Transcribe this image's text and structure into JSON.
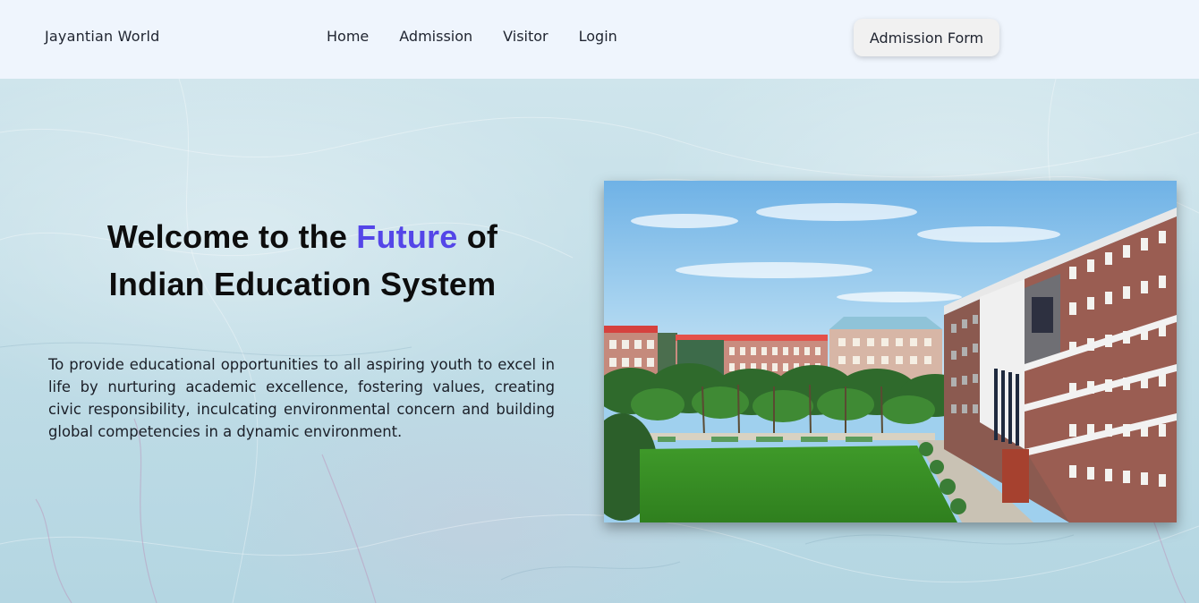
{
  "navbar": {
    "brand": "Jayantian World",
    "links": [
      {
        "label": "Home"
      },
      {
        "label": "Admission"
      },
      {
        "label": "Visitor"
      },
      {
        "label": "Login"
      }
    ],
    "cta_label": "Admission Form"
  },
  "hero": {
    "title_part1": "Welcome to the ",
    "title_accent": "Future",
    "title_part2": " of",
    "title_line2": "Indian Education System",
    "description": "To provide educational opportunities to all aspiring youth to excel in life by nurturing academic excellence, fostering values, creating civic responsibility, inculcating environmental concern and building global competencies in a dynamic environment.",
    "accent_color": "#5446e8"
  },
  "image": {
    "subject": "campus-photo"
  }
}
